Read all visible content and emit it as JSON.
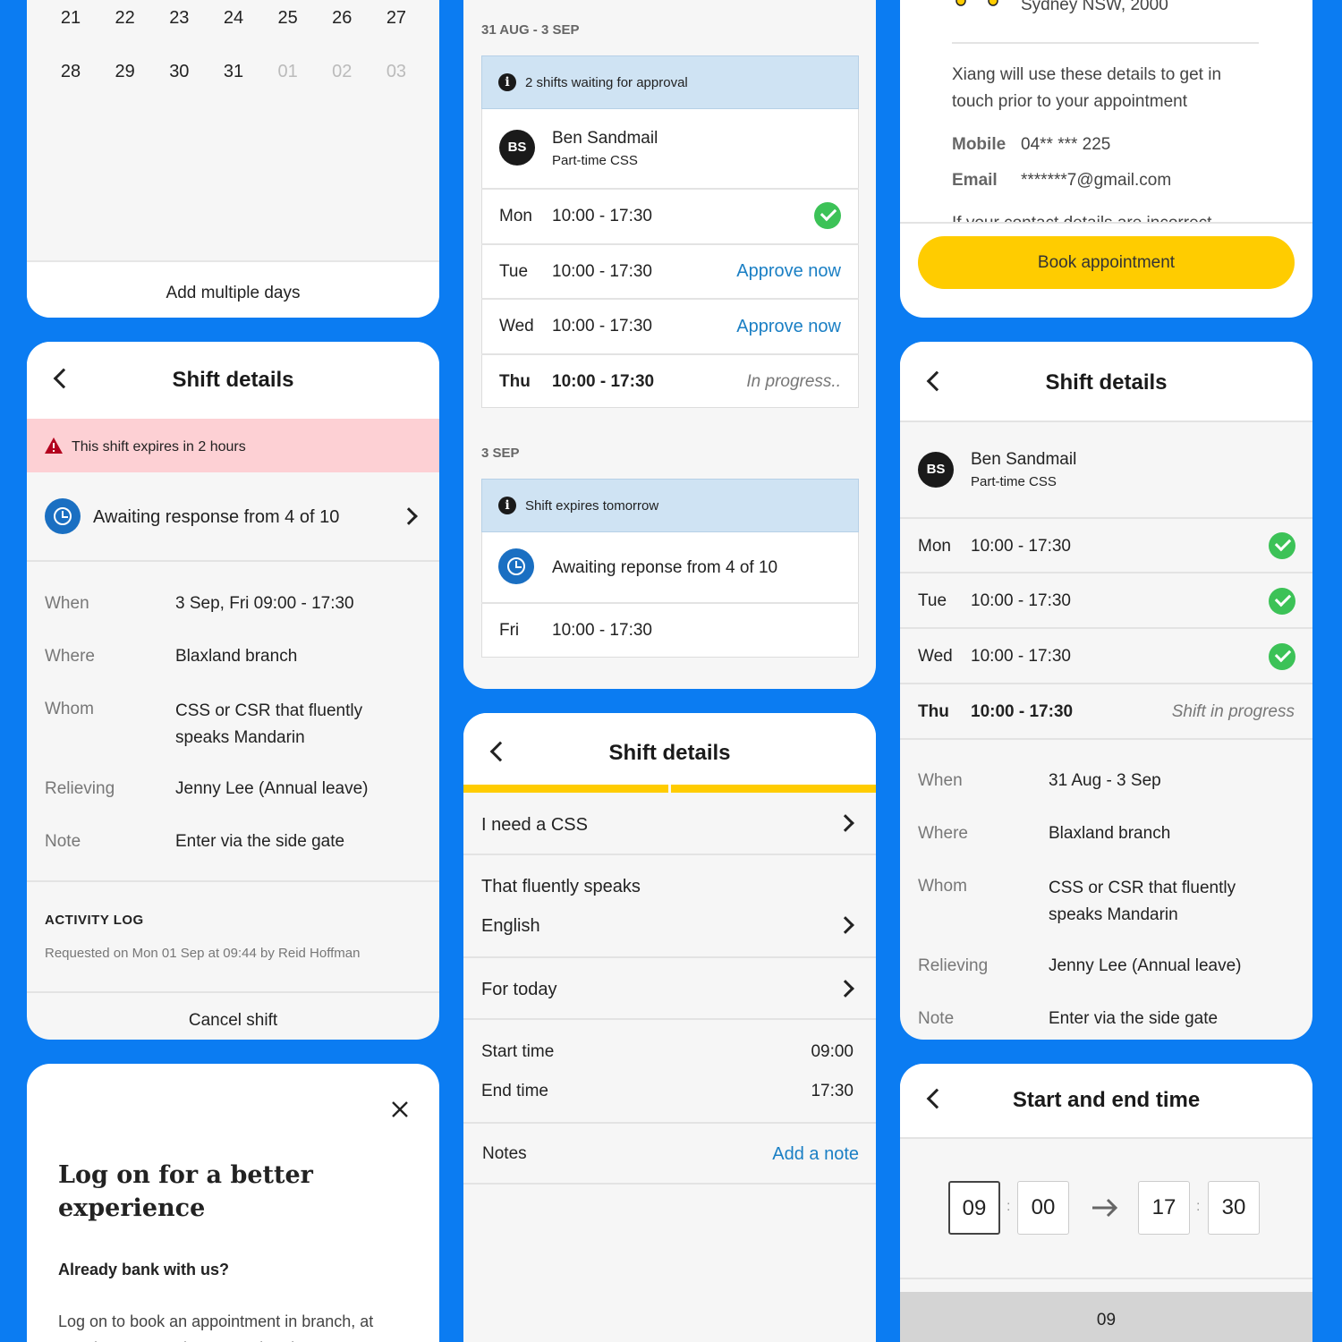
{
  "calendar": {
    "row1": [
      "21",
      "22",
      "23",
      "24",
      "25",
      "26",
      "27"
    ],
    "row2": [
      "28",
      "29",
      "30",
      "31",
      "01",
      "02",
      "03"
    ],
    "add_multiple": "Add multiple days"
  },
  "shift_left": {
    "title": "Shift details",
    "alert": "This shift expires in 2 hours",
    "awaiting": "Awaiting response from 4 of 10",
    "details": [
      {
        "label": "When",
        "value": "3 Sep, Fri 09:00 - 17:30"
      },
      {
        "label": "Where",
        "value": "Blaxland branch"
      },
      {
        "label": "Whom",
        "value": "CSS or CSR that fluently speaks Mandarin"
      },
      {
        "label": "Relieving",
        "value": "Jenny Lee (Annual leave)"
      },
      {
        "label": "Note",
        "value": "Enter via the side gate"
      }
    ],
    "activity_heading": "ACTIVITY LOG",
    "activity_entry": "Requested on Mon 01 Sep at 09:44 by Reid Hoffman",
    "cancel": "Cancel shift"
  },
  "login": {
    "title": "Log on for a better experience",
    "subtitle": "Already bank with us?",
    "body": "Log on to book an appointment in branch, at your home or work, or over the phone"
  },
  "approvals": {
    "range1": "31 AUG - 3 SEP",
    "banner1": "2 shifts waiting for approval",
    "person_initials": "BS",
    "person_name": "Ben Sandmail",
    "person_role": "Part-time CSS",
    "days": [
      {
        "day": "Mon",
        "time": "10:00 - 17:30",
        "status": ""
      },
      {
        "day": "Tue",
        "time": "10:00 - 17:30",
        "status": "Approve now"
      },
      {
        "day": "Wed",
        "time": "10:00 - 17:30",
        "status": "Approve now"
      },
      {
        "day": "Thu",
        "time": "10:00 - 17:30",
        "status": "In progress.."
      }
    ],
    "range2": "3 SEP",
    "banner2": "Shift expires tomorrow",
    "awaiting": "Awaiting reponse from 4 of 10",
    "fri_day": "Fri",
    "fri_time": "10:00 - 17:30"
  },
  "create": {
    "title": "Shift details",
    "need": "I need a CSS",
    "speaks_label": "That fluently speaks",
    "speaks_value": "English",
    "for_today": "For today",
    "start_label": "Start time",
    "start_value": "09:00",
    "end_label": "End time",
    "end_value": "17:30",
    "notes_label": "Notes",
    "notes_link": "Add a note",
    "progress_steps_done": 2,
    "accent": "#ffcc00"
  },
  "booking": {
    "address_tail": "Sydney NSW, 2000",
    "contact_note": "Xiang will use these details to get in touch prior to your appointment",
    "mobile_label": "Mobile",
    "mobile_value": "04** *** 225",
    "email_label": "Email",
    "email_value": "*******7@gmail.com",
    "cutoff": "If your contact details are incorrect",
    "book_button": "Book appointment"
  },
  "shift_right": {
    "title": "Shift details",
    "person_initials": "BS",
    "person_name": "Ben Sandmail",
    "person_role": "Part-time CSS",
    "days": [
      {
        "day": "Mon",
        "time": "10:00 - 17:30"
      },
      {
        "day": "Tue",
        "time": "10:00 - 17:30"
      },
      {
        "day": "Wed",
        "time": "10:00 - 17:30"
      },
      {
        "day": "Thu",
        "time": "10:00 - 17:30",
        "status": "Shift in progress"
      }
    ],
    "details": [
      {
        "label": "When",
        "value": "31 Aug - 3 Sep"
      },
      {
        "label": "Where",
        "value": "Blaxland branch"
      },
      {
        "label": "Whom",
        "value": "CSS or CSR that fluently speaks Mandarin"
      },
      {
        "label": "Relieving",
        "value": "Jenny Lee (Annual leave)"
      },
      {
        "label": "Note",
        "value": "Enter via the side gate"
      }
    ]
  },
  "time_picker": {
    "title": "Start and end time",
    "start_h": "09",
    "start_m": "00",
    "end_h": "17",
    "end_m": "30",
    "sep": ":",
    "wheel_value": "09"
  }
}
